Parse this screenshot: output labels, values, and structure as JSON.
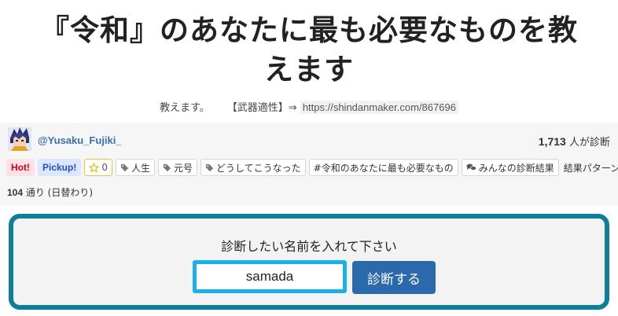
{
  "title": {
    "line1": "『令和』のあなたに最も必要なものを教",
    "line2": "えます"
  },
  "description": {
    "text": "教えます。",
    "bracket": "【武器適性】⇒",
    "url": "https://shindanmaker.com/867696"
  },
  "author": {
    "handle": "@Yusaku_Fujiki_",
    "avatar_icon": "anime-character-avatar"
  },
  "stats": {
    "count": "1,713",
    "count_suffix": "人が診断"
  },
  "tags": {
    "hot": "Hot!",
    "pickup": "Pickup!",
    "star_count": "0",
    "items": [
      "人生",
      "元号",
      "どうしてこうなった"
    ],
    "hashtag": "#令和のあなたに最も必要なもの",
    "results_link": "みんなの診断結果",
    "patterns_label": "結果パターン"
  },
  "patterns": {
    "count": "104",
    "suffix": "通り (日替わり)"
  },
  "form": {
    "prompt": "診断したい名前を入れて下さい",
    "name_value": "samada",
    "submit_label": "診断する"
  },
  "colors": {
    "form_border": "#0e7f9a",
    "input_border": "#1ab0e8",
    "button_bg": "#2b68ac",
    "link": "#3a6fb0"
  }
}
